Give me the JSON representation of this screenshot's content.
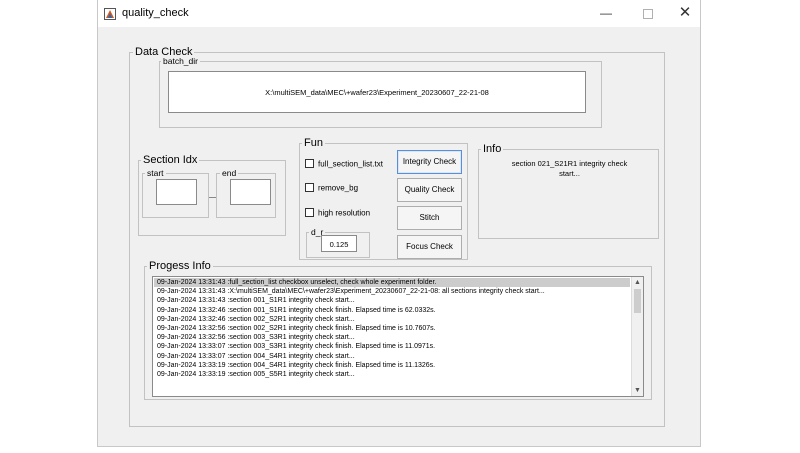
{
  "window": {
    "title": "quality_check",
    "minimize_glyph": "—",
    "close_glyph": "✕"
  },
  "data_check": {
    "legend": "Data Check",
    "batch_dir": {
      "legend": "batch_dir",
      "value": "X:\\multiSEM_data\\MEC\\+wafer23\\Experiment_20230607_22-21-08"
    }
  },
  "section_idx": {
    "legend": "Section Idx",
    "start_legend": "start",
    "end_legend": "end",
    "start_value": "",
    "end_value": ""
  },
  "fun": {
    "legend": "Fun",
    "checkboxes": [
      {
        "label": "full_section_list.txt",
        "checked": false
      },
      {
        "label": "remove_bg",
        "checked": false
      },
      {
        "label": "high resolution",
        "checked": false
      }
    ],
    "d_r": {
      "legend": "d_r",
      "value": "0.125"
    },
    "buttons": {
      "integrity": "Integrity Check",
      "quality": "Quality Check",
      "stitch": "Stitch",
      "focus": "Focus Check"
    }
  },
  "info": {
    "legend": "Info",
    "text_line1": "section 021_S21R1 integrity check",
    "text_line2": "start..."
  },
  "progress": {
    "legend": "Progess Info",
    "log": [
      "09-Jan-2024 13:31:43 :full_section_list checkbox unselect, check whole experiment folder.",
      "09-Jan-2024 13:31:43 :X:\\multiSEM_data\\MEC\\+wafer23\\Experiment_20230607_22-21-08: all sections integrity check start...",
      "09-Jan-2024 13:31:43 :section 001_S1R1 integrity check start...",
      "09-Jan-2024 13:32:46 :section 001_S1R1 integrity check finish. Elapsed time is 62.0332s.",
      "09-Jan-2024 13:32:46 :section 002_S2R1 integrity check start...",
      "09-Jan-2024 13:32:56 :section 002_S2R1 integrity check finish. Elapsed time is 10.7607s.",
      "09-Jan-2024 13:32:56 :section 003_S3R1 integrity check start...",
      "09-Jan-2024 13:33:07 :section 003_S3R1 integrity check finish. Elapsed time is 11.0971s.",
      "09-Jan-2024 13:33:07 :section 004_S4R1 integrity check start...",
      "09-Jan-2024 13:33:19 :section 004_S4R1 integrity check finish. Elapsed time is 11.1326s.",
      "09-Jan-2024 13:33:19 :section 005_S5R1 integrity check start..."
    ],
    "selected_index": 0
  },
  "icons": {
    "app": "matlab-figure-icon",
    "scroll_up": "chevron-up-icon",
    "scroll_down": "chevron-down-icon"
  }
}
